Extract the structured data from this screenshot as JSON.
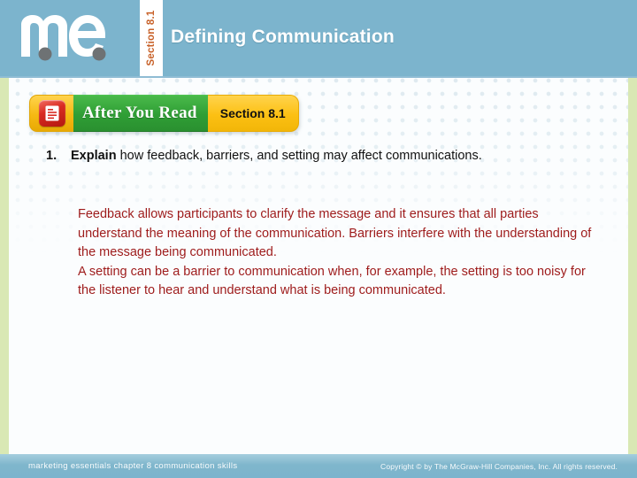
{
  "header": {
    "logo_text": "me",
    "logo_name": "me-marketing-essentials-logo",
    "section_tab": "Section 8.1",
    "title": "Defining Communication",
    "bg_color": "#7cb4cd",
    "section_tab_color": "#c8622a"
  },
  "banner": {
    "icon_name": "document-lines-icon",
    "label": "After You Read",
    "section_badge": "Section 8.1",
    "green_color": "#2f9e35",
    "gold_color": "#fcc013",
    "icon_color": "#d92b22"
  },
  "question": {
    "number": "1.",
    "lead_word": "Explain",
    "text": " how feedback, barriers, and setting may affect communications."
  },
  "answer": {
    "color": "#9e1b1b",
    "paragraph_1": "Feedback allows participants to clarify the message and it ensures that all parties understand the meaning of the communication. Barriers interfere with the understanding of the message being communicated.",
    "paragraph_2": "A setting can be a barrier to communication when, for example, the setting is too noisy for the listener to hear and understand what is being communicated."
  },
  "footer": {
    "left_text": "marketing essentials  chapter 8  communication skills",
    "right_text": "Copyright © by The McGraw-Hill Companies, Inc. All rights reserved.",
    "bg_color": "#7cb4cd"
  },
  "decoration": {
    "edge_strip_color": "#d9e8b4",
    "canvas_color": "#fbfdfe"
  }
}
